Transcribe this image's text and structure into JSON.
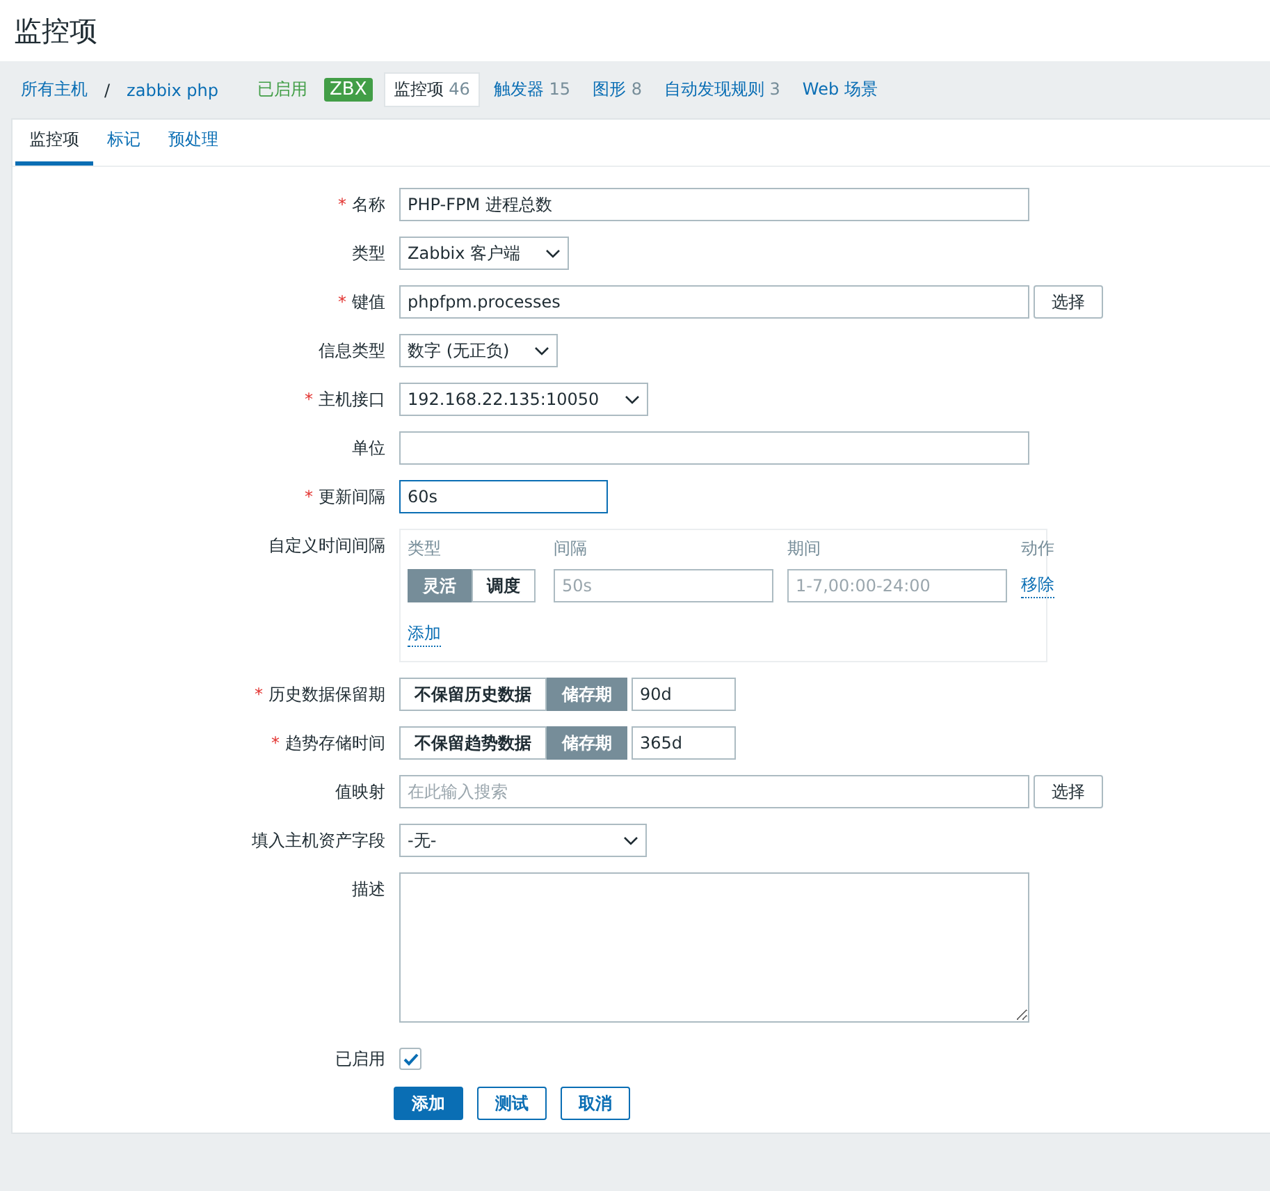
{
  "page_title": "监控项",
  "nav": {
    "links": [
      {
        "text": "所有主机"
      },
      {
        "text": "zabbix php"
      }
    ],
    "separator": "/",
    "status": "已启用",
    "badge": "ZBX",
    "tabs": [
      {
        "label": "监控项",
        "count": "46",
        "selected": true
      },
      {
        "label": "触发器",
        "count": "15",
        "selected": false
      },
      {
        "label": "图形",
        "count": "8",
        "selected": false
      },
      {
        "label": "自动发现规则",
        "count": "3",
        "selected": false
      },
      {
        "label": "Web 场景",
        "selected": false
      }
    ]
  },
  "subtabs": [
    {
      "label": "监控项",
      "selected": true
    },
    {
      "label": "标记",
      "selected": false
    },
    {
      "label": "预处理",
      "selected": false
    }
  ],
  "form": [
    {
      "kind": "text",
      "label": "名称",
      "required_mark": "*",
      "value": "PHP-FPM 进程总数"
    },
    {
      "kind": "select",
      "label": "类型",
      "value": "Zabbix 客户端"
    },
    {
      "kind": "text_button",
      "label": "键值",
      "required_mark": "*",
      "value": "phpfpm.processes",
      "button": "选择"
    },
    {
      "kind": "select",
      "label": "信息类型",
      "value": "数字 (无正负)"
    },
    {
      "kind": "select",
      "label": "主机接口",
      "required_mark": "*",
      "value": "192.168.22.135:10050"
    },
    {
      "kind": "text",
      "label": "单位"
    },
    {
      "kind": "text_short",
      "label": "更新间隔",
      "required_mark": "*",
      "value": "60s",
      "focused": true
    },
    {
      "kind": "intervals",
      "label": "自定义时间间隔",
      "headers": [
        "类型",
        "间隔",
        "期间",
        "动作"
      ],
      "rows": [
        {
          "types": [
            {
              "label": "灵活",
              "selected": true
            },
            {
              "label": "调度",
              "selected": false
            }
          ],
          "interval_placeholder": "50s",
          "period_placeholder": "1-7,00:00-24:00",
          "action": "移除"
        }
      ],
      "add": "添加"
    },
    {
      "kind": "storage",
      "label": "历史数据保留期",
      "required_mark": "*",
      "options": [
        {
          "label": "不保留历史数据",
          "selected": false
        },
        {
          "label": "储存期",
          "selected": true
        }
      ],
      "value": "90d"
    },
    {
      "kind": "storage",
      "label": "趋势存储时间",
      "required_mark": "*",
      "options": [
        {
          "label": "不保留趋势数据",
          "selected": false
        },
        {
          "label": "储存期",
          "selected": true
        }
      ],
      "value": "365d"
    },
    {
      "kind": "text_button",
      "label": "值映射",
      "placeholder": "在此输入搜索",
      "button": "选择"
    },
    {
      "kind": "select_wide",
      "label": "填入主机资产字段",
      "value": "-无-"
    },
    {
      "kind": "textarea",
      "label": "描述"
    },
    {
      "kind": "checkbox",
      "label": "已启用",
      "checked": true
    }
  ],
  "buttons": [
    {
      "label": "添加",
      "kind": "primary"
    },
    {
      "label": "测试",
      "kind": "secondary"
    },
    {
      "label": "取消",
      "kind": "secondary"
    }
  ]
}
